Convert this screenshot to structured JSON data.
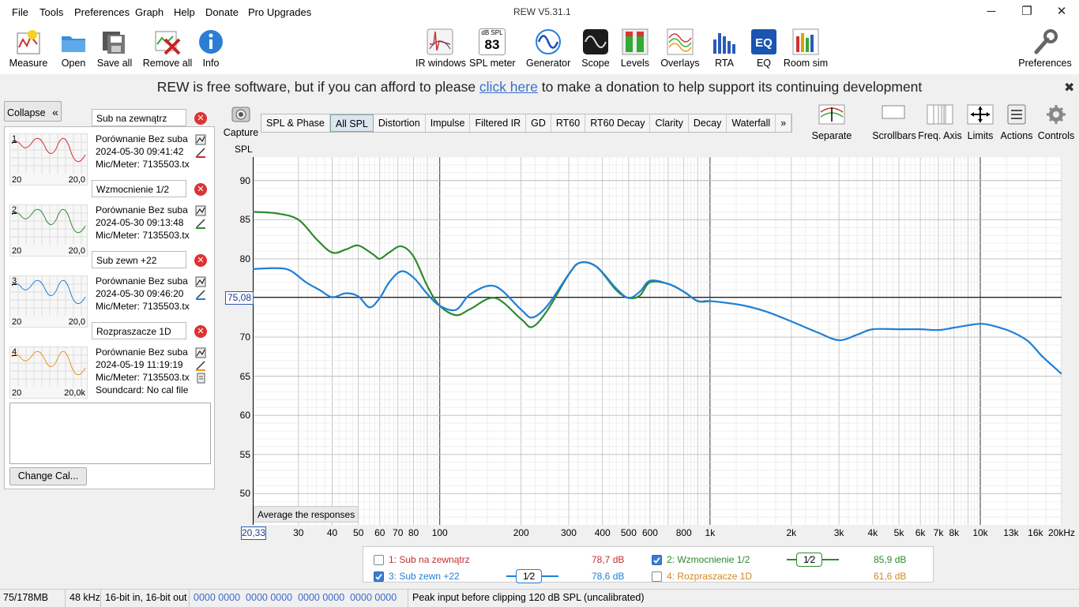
{
  "window": {
    "title": "REW V5.31.1",
    "min": "─",
    "max": "❐",
    "close": "✕"
  },
  "menu": [
    "File",
    "Tools",
    "Preferences",
    "Graph",
    "Help",
    "Donate",
    "Pro Upgrades"
  ],
  "toolbar": {
    "measure": "Measure",
    "open": "Open",
    "save_all": "Save all",
    "remove_all": "Remove all",
    "info": "Info",
    "ir_windows": "IR windows",
    "spl_meter": "SPL meter",
    "spl_meter_unit": "dB SPL",
    "spl_meter_value": "83",
    "generator": "Generator",
    "scope": "Scope",
    "levels": "Levels",
    "overlays": "Overlays",
    "rta": "RTA",
    "eq": "EQ",
    "room_sim": "Room sim",
    "preferences": "Preferences"
  },
  "donate": {
    "before": "REW is free software, but if you can afford to please ",
    "link": "click here",
    "after": " to make a donation to help support its continuing development",
    "close": "✖"
  },
  "left_panel": {
    "collapse": "Collapse",
    "collapse_icon": "«",
    "change_cal": "Change Cal...",
    "measurements": [
      {
        "num": "1",
        "name": "Sub na zewnątrz",
        "desc": "Porównanie Bez suba",
        "date": "2024-05-30 09:41:42",
        "mic": "Mic/Meter: 7135503.tx",
        "lo": "20",
        "hi": "20,0",
        "color": "#d42a2a"
      },
      {
        "num": "2",
        "name": "Wzmocnienie 1/2",
        "desc": "Porównanie Bez suba",
        "date": "2024-05-30 09:13:48",
        "mic": "Mic/Meter: 7135503.tx",
        "lo": "20",
        "hi": "20,0",
        "color": "#2d8a2d"
      },
      {
        "num": "3",
        "name": "Sub zewn +22",
        "desc": "Porównanie Bez suba",
        "date": "2024-05-30 09:46:20",
        "mic": "Mic/Meter: 7135503.tx",
        "lo": "20",
        "hi": "20,0",
        "color": "#1f7fd6"
      },
      {
        "num": "4",
        "name": "Rozpraszacze 1D",
        "desc": "Porównanie Bez suba",
        "date": "2024-05-19 11:19:19",
        "mic": "Mic/Meter: 7135503.tx",
        "soundcard": "Soundcard: No cal file",
        "lo": "20",
        "hi": "20,0k",
        "color": "#e69420"
      }
    ]
  },
  "graph_tools": {
    "capture": "Capture",
    "tabs": [
      "SPL & Phase",
      "All SPL",
      "Distortion",
      "Impulse",
      "Filtered IR",
      "GD",
      "RT60",
      "RT60 Decay",
      "Clarity",
      "Decay",
      "Waterfall",
      "»"
    ],
    "active_tab": "All SPL",
    "separate": "Separate",
    "scrollbars": "Scrollbars",
    "freq_axis": "Freq. Axis",
    "limits": "Limits",
    "actions": "Actions",
    "controls": "Controls"
  },
  "chart_data": {
    "type": "line",
    "ylabel": "SPL",
    "x_scale": "log",
    "xlim": [
      20.33,
      20000
    ],
    "ylim": [
      46,
      93
    ],
    "y_ticks": [
      "90",
      "85",
      "80",
      "75",
      "70",
      "65",
      "60",
      "55",
      "50"
    ],
    "x_ticks": [
      "30",
      "40",
      "50",
      "60",
      "70",
      "80",
      "100",
      "200",
      "300",
      "400",
      "500",
      "600",
      "800",
      "1k",
      "2k",
      "3k",
      "4k",
      "5k",
      "6k",
      "7k",
      "8k",
      "10k",
      "13k",
      "16k",
      "20kHz"
    ],
    "cursor_y": "75,08",
    "cursor_x": "20,33",
    "cursor_y_value": 75.08,
    "average_button": "Average the responses",
    "series": [
      {
        "name": "2: Wzmocnienie 1/2",
        "color": "#2d8a2d",
        "x": [
          20.33,
          25,
          30,
          35,
          40,
          45,
          50,
          57,
          60,
          65,
          72,
          80,
          90,
          100,
          115,
          130,
          160,
          200,
          220,
          250,
          300,
          330,
          380,
          450,
          500,
          550,
          600,
          700,
          800,
          900,
          1000
        ],
        "y": [
          86,
          85.8,
          85,
          82.5,
          80.8,
          81.2,
          81.7,
          80.5,
          80.0,
          80.8,
          81.6,
          80.3,
          76.5,
          74.0,
          72.8,
          73.6,
          75.0,
          72.3,
          71.3,
          73.4,
          78.0,
          79.5,
          79.0,
          76.0,
          75.0,
          75.3,
          77.0,
          76.8,
          75.8,
          74.6,
          74.6
        ]
      },
      {
        "name": "3: Sub zewn +22",
        "color": "#1f7fd6",
        "x": [
          20.33,
          25,
          28,
          32,
          36,
          40,
          45,
          50,
          55,
          60,
          65,
          72,
          80,
          90,
          100,
          115,
          130,
          160,
          200,
          220,
          250,
          300,
          330,
          380,
          450,
          500,
          550,
          600,
          700,
          800,
          900,
          1000,
          1300,
          1600,
          2000,
          2500,
          3000,
          3500,
          4000,
          5000,
          6000,
          7000,
          8000,
          9000,
          10000,
          11000,
          13000,
          15000,
          17000,
          20000
        ],
        "y": [
          78.7,
          78.8,
          78.5,
          77.0,
          76.0,
          75.1,
          75.6,
          75.2,
          73.8,
          75.0,
          77.0,
          78.4,
          77.6,
          75.5,
          74.0,
          73.5,
          75.5,
          76.5,
          73.5,
          72.5,
          74.0,
          78.0,
          79.5,
          79.0,
          76.2,
          75.0,
          75.8,
          77.2,
          76.8,
          75.8,
          74.6,
          74.6,
          74.1,
          73.3,
          72.0,
          70.6,
          69.6,
          70.3,
          71.0,
          71.0,
          71.0,
          70.9,
          71.2,
          71.5,
          71.7,
          71.5,
          70.7,
          69.5,
          67.5,
          65.3
        ]
      }
    ]
  },
  "legend": [
    {
      "label": "1: Sub na zewnątrz",
      "value": "78,7 dB",
      "checked": false,
      "color": "#c03030",
      "smoothing": ""
    },
    {
      "label": "2: Wzmocnienie 1/2",
      "value": "85,9 dB",
      "checked": true,
      "color": "#2d8a2d",
      "smoothing": "1⁄2"
    },
    {
      "label": "3: Sub zewn +22",
      "value": "78,6 dB",
      "checked": true,
      "color": "#1f7fd6",
      "smoothing": "1⁄2"
    },
    {
      "label": "4: Rozpraszacze 1D",
      "value": "61,6 dB",
      "checked": false,
      "color": "#d08820",
      "smoothing": ""
    }
  ],
  "status": {
    "memory": "75/178MB",
    "rate": "48 kHz",
    "bits": "16-bit in, 16-bit out",
    "levels": "0000 0000  0000 0000  0000 0000  0000 0000",
    "peak": "Peak input before clipping 120 dB SPL (uncalibrated)"
  }
}
